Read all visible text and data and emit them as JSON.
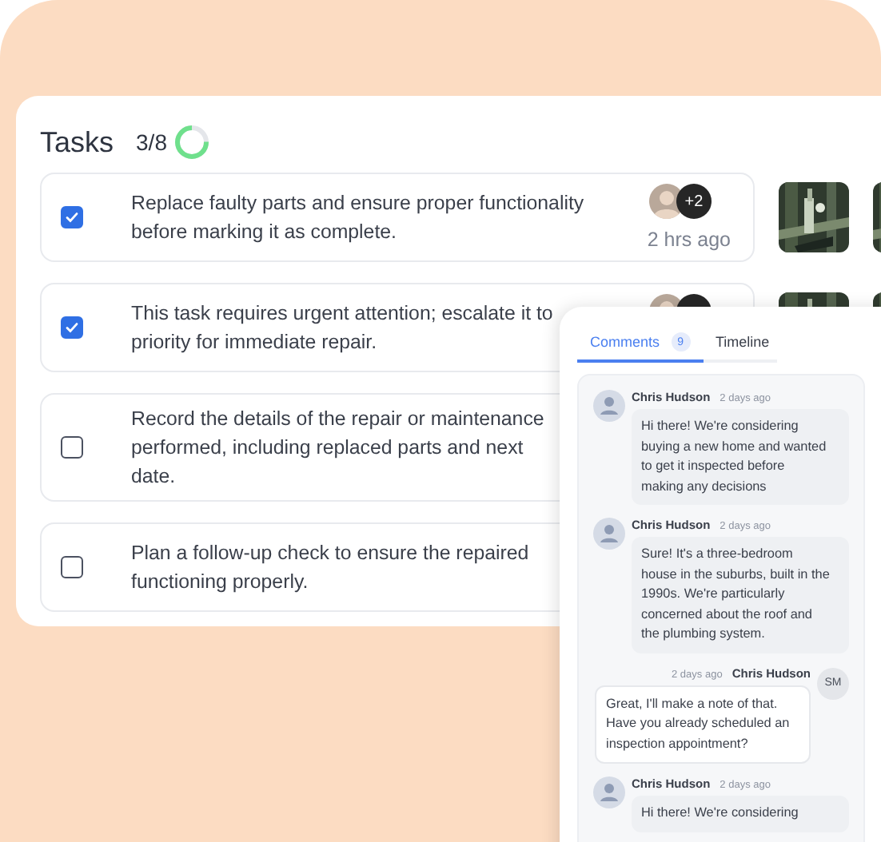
{
  "header": {
    "title": "Tasks",
    "count": "3/8",
    "progress": {
      "level": 0.75
    }
  },
  "tasks": [
    {
      "lines": [
        "Replace faulty parts and ensure proper functionality",
        "before marking it as complete."
      ],
      "checked": true,
      "avatars": true,
      "more": "+2",
      "time": "2 hrs ago",
      "photos": true
    },
    {
      "lines": [
        "This task requires urgent attention; escalate it to",
        "priority for immediate repair."
      ],
      "checked": true,
      "avatars": true,
      "photos": true
    },
    {
      "lines": [
        "Record the details of the repair or maintenance",
        "performed, including replaced parts and next",
        "date."
      ],
      "checked": false
    },
    {
      "lines": [
        "Plan a follow-up check to ensure the repaired",
        "functioning properly."
      ],
      "checked": false
    }
  ],
  "panel": {
    "tabs": [
      {
        "label": "Comments",
        "badge": "9",
        "selected": true
      },
      {
        "label": "Timeline",
        "selected": false
      }
    ],
    "comments": [
      {
        "kind": "incoming",
        "author": "Chris Hudson",
        "time": "2 days ago",
        "text": "Hi there! We're considering buying a new home and wanted to get it inspected before making any decisions"
      },
      {
        "kind": "incoming",
        "author": "Chris Hudson",
        "time": "2 days ago",
        "text": "Sure! It's a three-bedroom house in the suburbs, built in the 1990s. We're particularly concerned about the roof and the plumbing system."
      },
      {
        "kind": "outgoing",
        "author": "Chris Hudson",
        "time": "2 days ago",
        "initials": "SM",
        "text": "Great, I'll make a note of that. Have you already scheduled an inspection appointment?"
      },
      {
        "kind": "incoming",
        "author": "Chris Hudson",
        "time": "2 days ago",
        "text": "Hi there! We're considering"
      }
    ]
  }
}
